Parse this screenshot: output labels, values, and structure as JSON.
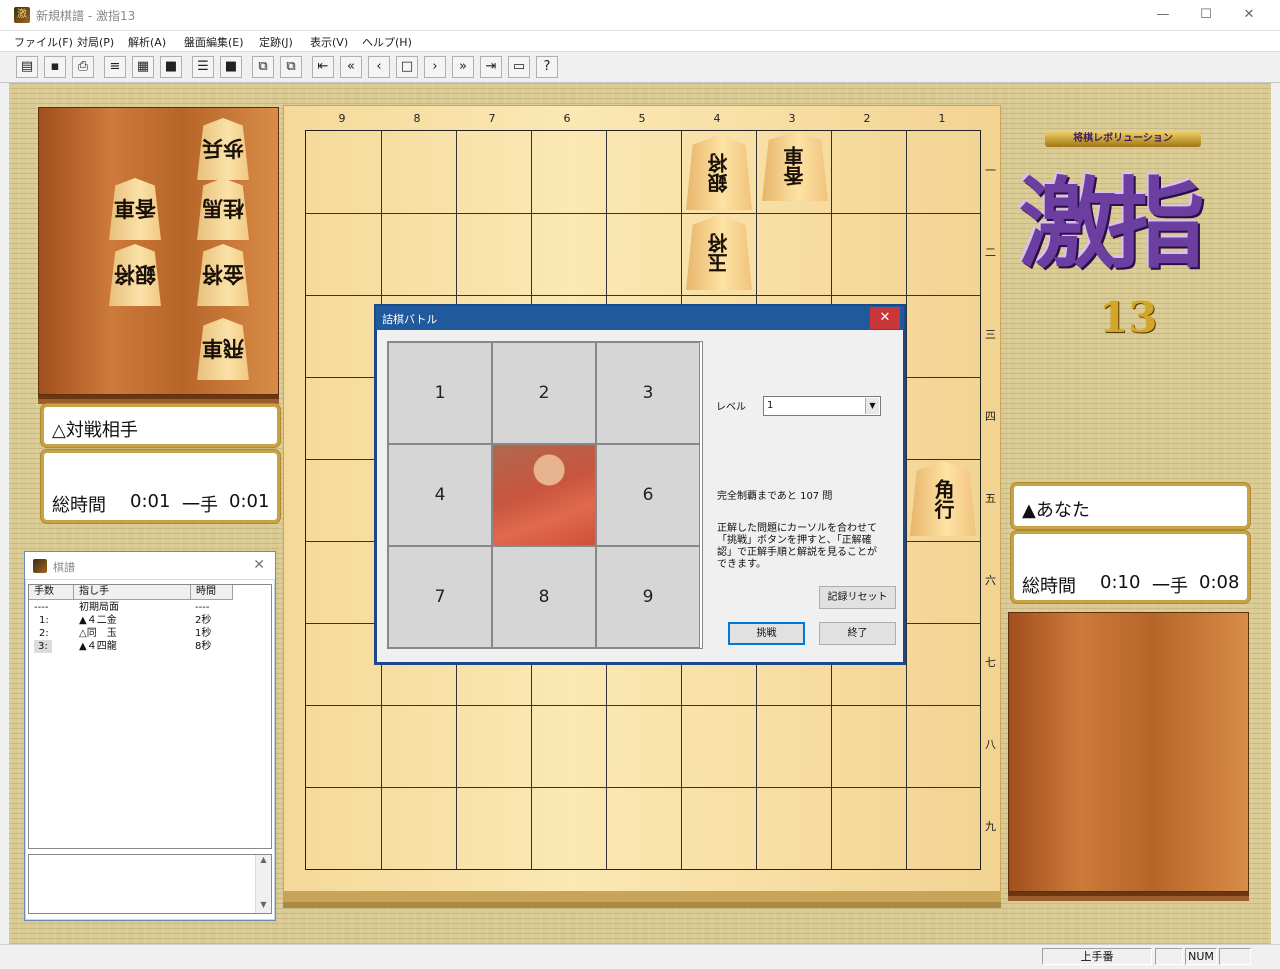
{
  "window": {
    "title": "新規棋譜 - 激指13"
  },
  "menu": [
    "ファイル(F)",
    "対局(P)",
    "解析(A)",
    "盤面編集(E)",
    "定跡(J)",
    "表示(V)",
    "ヘルプ(H)"
  ],
  "board": {
    "files": [
      "9",
      "8",
      "7",
      "6",
      "5",
      "4",
      "3",
      "2",
      "1"
    ],
    "ranks": [
      "一",
      "二",
      "三",
      "四",
      "五",
      "六",
      "七",
      "八",
      "九"
    ],
    "pieces": [
      {
        "label": "銀将",
        "owner": "gote"
      },
      {
        "label": "香車",
        "owner": "gote"
      },
      {
        "label": "玉将",
        "owner": "gote"
      },
      {
        "label": "角行",
        "owner": "sente"
      }
    ]
  },
  "gote_hand": [
    "歩兵",
    "香車",
    "桂馬",
    "銀将",
    "金将",
    "飛車"
  ],
  "players": {
    "gote": {
      "name": "△対戦相手",
      "total_label": "総時間",
      "total": "0:01",
      "move_label": "一手",
      "move": "0:01"
    },
    "sente": {
      "name": "▲あなた",
      "total_label": "総時間",
      "total": "0:10",
      "move_label": "一手",
      "move": "0:08"
    }
  },
  "logo": {
    "subtitle": "将棋レボリューション",
    "main": "激指",
    "number": "13"
  },
  "kifu": {
    "title": "棋譜",
    "headers": [
      "手数",
      "指し手",
      "時間"
    ],
    "rows": [
      {
        "num": "----",
        "move": "初期局面",
        "time": "----"
      },
      {
        "num": "1:",
        "move": "▲４二金",
        "time": "2秒"
      },
      {
        "num": "2:",
        "move": "△同　玉",
        "time": "1秒"
      },
      {
        "num": "3:",
        "move": "▲４四龍",
        "time": "8秒"
      }
    ]
  },
  "dialog": {
    "title": "詰棋バトル",
    "cells": [
      "1",
      "2",
      "3",
      "4",
      "",
      "6",
      "7",
      "8",
      "9"
    ],
    "level_label": "レベル",
    "level_value": "1",
    "remaining": "完全制覇まであと 107 問",
    "hint": "正解した問題にカーソルを合わせて「挑戦」ボタンを押すと、「正解確認」で正解手順と解説を見ることができます。",
    "reset": "記録リセット",
    "challenge": "挑戦",
    "end": "終了"
  },
  "status": {
    "turn": "上手番",
    "num": "NUM"
  }
}
